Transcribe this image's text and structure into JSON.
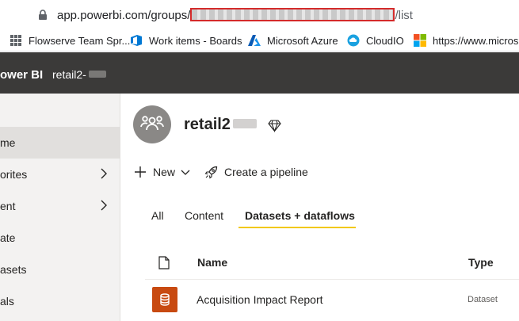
{
  "browser": {
    "url_host": "app.powerbi.com/groups/",
    "url_tail": "/list"
  },
  "bookmarks": [
    {
      "label": "Flowserve Team Spr...",
      "icon": "grid-icon"
    },
    {
      "label": "Work items - Boards",
      "icon": "azure-devops-icon"
    },
    {
      "label": "Microsoft Azure",
      "icon": "azure-icon"
    },
    {
      "label": "CloudIO",
      "icon": "cloudio-icon"
    },
    {
      "label": "https://www.micros...",
      "icon": "microsoft-logo-icon"
    }
  ],
  "topbar": {
    "brand": "ower BI",
    "workspace": "retail2-"
  },
  "leftnav": [
    {
      "label": "me",
      "active": true,
      "chevron": false
    },
    {
      "label": "orites",
      "active": false,
      "chevron": true
    },
    {
      "label": "ent",
      "active": false,
      "chevron": true
    },
    {
      "label": "ate",
      "active": false,
      "chevron": false
    },
    {
      "label": "asets",
      "active": false,
      "chevron": false
    },
    {
      "label": "als",
      "active": false,
      "chevron": false
    }
  ],
  "workspace": {
    "title": "retail2",
    "icon": "workspace-people-icon",
    "premium_icon": "diamond-icon"
  },
  "actions": {
    "new_label": "New",
    "pipeline_label": "Create a pipeline"
  },
  "tabs": [
    {
      "label": "All",
      "active": false
    },
    {
      "label": "Content",
      "active": false
    },
    {
      "label": "Datasets + dataflows",
      "active": true
    }
  ],
  "table": {
    "headers": {
      "name": "Name",
      "type": "Type"
    },
    "rows": [
      {
        "name": "Acquisition Impact Report",
        "type": "Dataset",
        "icon": "dataset-icon",
        "icon_color": "#c84a11"
      }
    ]
  },
  "colors": {
    "topbar": "#3b3a39",
    "accent": "#f2c811",
    "redaction_border": "#d42b2b"
  }
}
